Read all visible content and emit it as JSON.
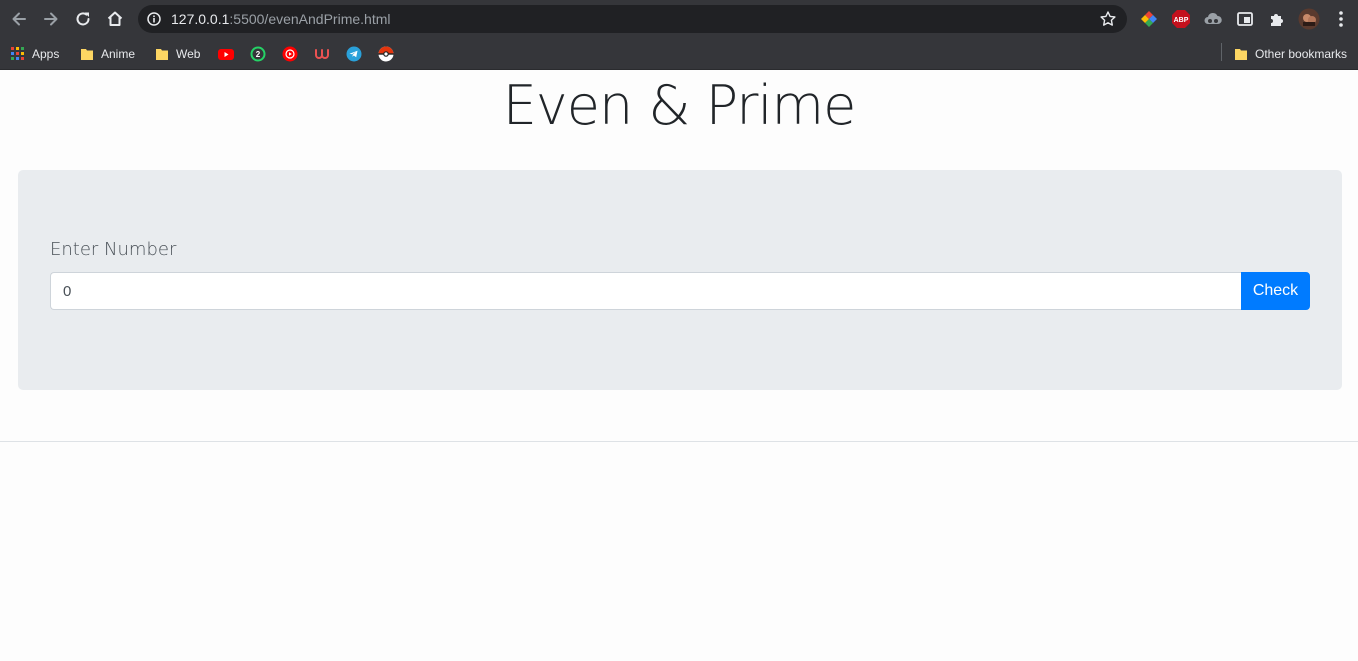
{
  "browser": {
    "url_host": "127.0.0.1",
    "url_rest": ":5500/evenAndPrime.html",
    "extensions": [
      "colorful-extension-icon",
      "adblock-plus-icon",
      "cloud-extension-icon",
      "media-router-icon",
      "puzzle-icon",
      "profile-avatar",
      "more-menu-icon"
    ],
    "abp_label": "ABP",
    "whatsapp_badge": "2"
  },
  "bookmarks": {
    "apps": "Apps",
    "folders": [
      "Anime",
      "Web"
    ],
    "other": "Other bookmarks"
  },
  "page": {
    "title": "Even & Prime",
    "form": {
      "label": "Enter Number",
      "input_value": "0",
      "button_label": "Check"
    },
    "colors": {
      "primary": "#007bff",
      "jumbotron": "#e9ecef",
      "text": "#212529"
    }
  }
}
